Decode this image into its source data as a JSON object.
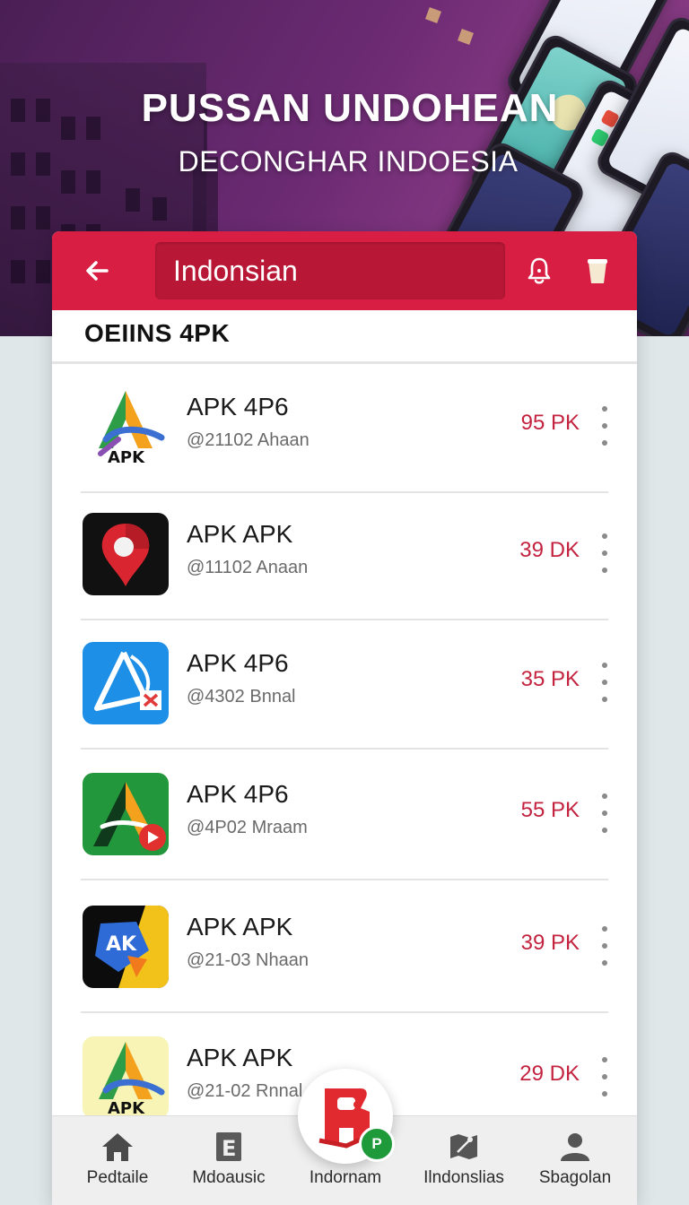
{
  "hero": {
    "title": "PUSSAN UNDOHEAN",
    "subtitle": "DECONGHAR INDOESIA"
  },
  "topbar": {
    "back_icon": "arrow-left-icon",
    "search_value": "Indonsian",
    "bell_icon": "bell-icon",
    "cup_icon": "cup-icon",
    "accent_color": "#d81f43"
  },
  "section": {
    "title": "OEIINS 4PK"
  },
  "apps": [
    {
      "name": "APK 4P6",
      "sub": "@21102 Ahaan",
      "size": "95 PK",
      "icon": "apk-a-logo-white"
    },
    {
      "name": "APK APK",
      "sub": "@11102 Anaan",
      "size": "39 DK",
      "icon": "map-pin-logo"
    },
    {
      "name": "APK 4P6",
      "sub": "@4302 Bnnal",
      "size": "35 PK",
      "icon": "apk-a-logo-blue"
    },
    {
      "name": "APK 4P6",
      "sub": "@4P02 Mraam",
      "size": "55 PK",
      "icon": "apk-a-logo-green"
    },
    {
      "name": "APK APK",
      "sub": "@21-03 Nhaan",
      "size": "39 PK",
      "icon": "apk-a-logo-dark"
    },
    {
      "name": "APK APK",
      "sub": "@21-02 Rnnal",
      "size": "29 DK",
      "icon": "apk-a-logo-yellow"
    }
  ],
  "bottom_nav": [
    {
      "label": "Pedtaile",
      "icon": "home-icon"
    },
    {
      "label": "Mdoausic",
      "icon": "e-doc-icon"
    },
    {
      "label": "Indornam",
      "icon": "app-store-icon"
    },
    {
      "label": "Ilndonslias",
      "icon": "map-icon"
    },
    {
      "label": "Sbagolan",
      "icon": "person-icon"
    }
  ],
  "fab": {
    "badge": "P"
  }
}
